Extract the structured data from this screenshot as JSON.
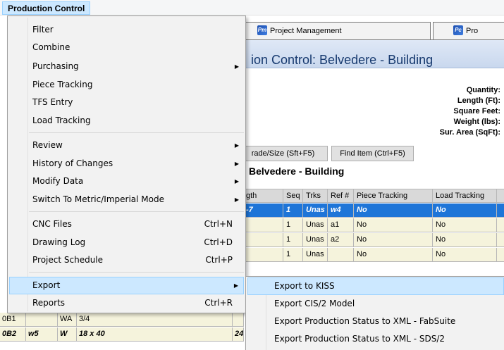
{
  "menubar": {
    "title": "Production Control"
  },
  "tabs": [
    {
      "label": "Project Management",
      "logo": "Pm"
    },
    {
      "label": "Pro",
      "logo": "Pc"
    }
  ],
  "banner": {
    "title": "ion Control: Belvedere - Building"
  },
  "stats": [
    "Quantity:",
    "Length (Ft):",
    "Square Feet:",
    "Weight (lbs):",
    "Sur. Area (SqFt):"
  ],
  "buttons": {
    "grade_size": "rade/Size (Sft+F5)",
    "find_item": "Find Item (Ctrl+F5)"
  },
  "subtitle": "Belvedere - Building",
  "grid": {
    "columns": [
      "gth",
      "Seq",
      "Trks",
      "Ref #",
      "Piece Tracking",
      "Load Tracking",
      ""
    ],
    "rows": [
      [
        "-7",
        "1",
        "Unas",
        "w4",
        "No",
        "No",
        ""
      ],
      [
        "",
        "1",
        "Unas",
        "a1",
        "No",
        "No",
        ""
      ],
      [
        "",
        "1",
        "Unas",
        "a2",
        "No",
        "No",
        ""
      ],
      [
        "",
        "1",
        "Unas",
        "",
        "No",
        "No",
        ""
      ]
    ]
  },
  "left_rows": [
    [
      "0B1",
      "",
      "WA",
      "3/4",
      ""
    ],
    [
      "0B2",
      "w5",
      "W",
      "18 x 40",
      "24"
    ]
  ],
  "menu": {
    "items": [
      {
        "label": "Filter",
        "shortcut": "",
        "submenu": false
      },
      {
        "label": "Combine",
        "shortcut": "",
        "submenu": false
      },
      {
        "label": "Purchasing",
        "shortcut": "",
        "submenu": true
      },
      {
        "label": "Piece Tracking",
        "shortcut": "",
        "submenu": false
      },
      {
        "label": "TFS Entry",
        "shortcut": "",
        "submenu": false
      },
      {
        "label": "Load Tracking",
        "shortcut": "",
        "submenu": false
      },
      {
        "label": "Review",
        "shortcut": "",
        "submenu": true
      },
      {
        "label": "History of Changes",
        "shortcut": "",
        "submenu": true
      },
      {
        "label": "Modify Data",
        "shortcut": "",
        "submenu": true
      },
      {
        "label": "Switch To Metric/Imperial Mode",
        "shortcut": "",
        "submenu": true
      },
      {
        "label": "CNC Files",
        "shortcut": "Ctrl+N",
        "submenu": false
      },
      {
        "label": "Drawing Log",
        "shortcut": "Ctrl+D",
        "submenu": false
      },
      {
        "label": "Project Schedule",
        "shortcut": "Ctrl+P",
        "submenu": false
      },
      {
        "label": "Export",
        "shortcut": "",
        "submenu": true
      },
      {
        "label": "Reports",
        "shortcut": "Ctrl+R",
        "submenu": false
      }
    ]
  },
  "submenu": {
    "items": [
      "Export to KISS",
      "Export CIS/2 Model",
      "Export Production Status to XML - FabSuite",
      "Export Production Status to XML - SDS/2"
    ]
  }
}
